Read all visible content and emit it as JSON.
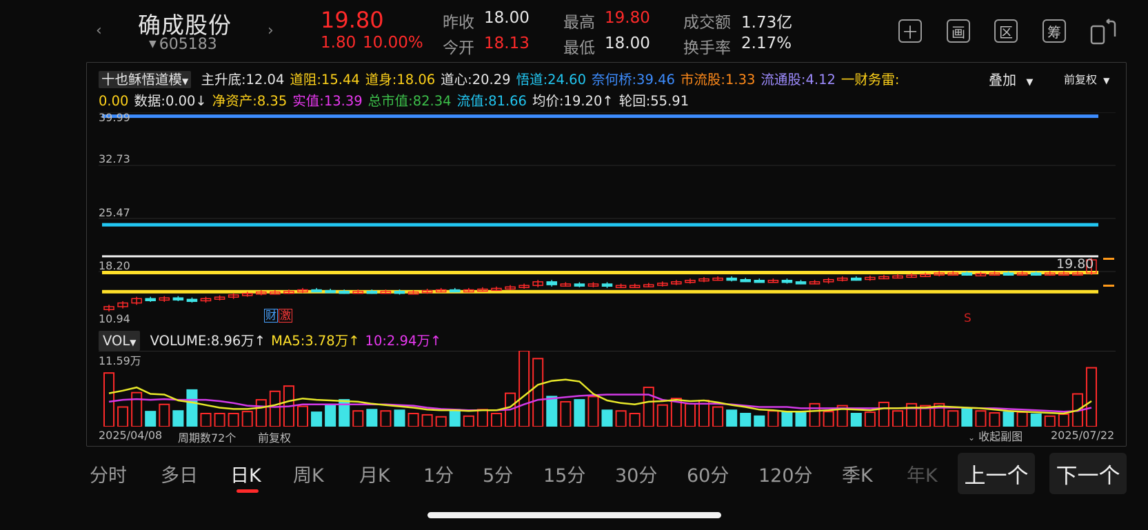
{
  "header": {
    "name": "确成股份",
    "code": "605183",
    "price": "19.80",
    "change": "1.80",
    "change_pct": "10.00%",
    "stats": [
      {
        "label": "昨收",
        "value": "18.00",
        "color": "#e8e8e8"
      },
      {
        "label": "今开",
        "value": "18.13",
        "color": "#ff2a2a"
      },
      {
        "label": "最高",
        "value": "19.80",
        "color": "#ff2a2a"
      },
      {
        "label": "最低",
        "value": "18.00",
        "color": "#e8e8e8"
      },
      {
        "label": "成交额",
        "value": "1.73亿",
        "color": "#e8e8e8"
      },
      {
        "label": "换手率",
        "value": "2.17%",
        "color": "#e8e8e8"
      }
    ],
    "tools": [
      "十",
      "画",
      "区",
      "筹"
    ]
  },
  "indicator": {
    "selector": "十也稣悟道模",
    "line1": [
      {
        "text": "主升底:12.04",
        "color": "#e8e8e8"
      },
      {
        "text": "道阻:15.44",
        "color": "#ffd21a"
      },
      {
        "text": "道身:18.06",
        "color": "#ffd21a"
      },
      {
        "text": "道心:20.29",
        "color": "#e8e8e8"
      },
      {
        "text": "悟道:24.60",
        "color": "#22c7f2"
      },
      {
        "text": "奈何桥:39.46",
        "color": "#3d8dff"
      },
      {
        "text": "市流股:1.33",
        "color": "#ff8a1a"
      },
      {
        "text": "流通股:4.12",
        "color": "#9e8cff"
      },
      {
        "text": "一财务雷:",
        "color": "#ffd21a"
      }
    ],
    "line2": [
      {
        "text": "0.00",
        "color": "#ffd21a"
      },
      {
        "text": "数据:0.00↓",
        "color": "#e8e8e8"
      },
      {
        "text": "净资产:8.35",
        "color": "#ffd21a"
      },
      {
        "text": "实值:13.39",
        "color": "#e838f0"
      },
      {
        "text": "总市值:82.34",
        "color": "#3cc04a"
      },
      {
        "text": "流值:81.66",
        "color": "#22c7f2"
      },
      {
        "text": "均价:19.20↑",
        "color": "#e8e8e8"
      },
      {
        "text": "轮回:55.91",
        "color": "#e8e8e8"
      }
    ],
    "overlay": "叠加",
    "adjust": "前复权"
  },
  "kline": {
    "axis_ticks": [
      "39.99",
      "32.73",
      "25.47",
      "18.20",
      "10.94"
    ],
    "last_price_label": "19.80",
    "marker_cai": "财",
    "marker_ji": "激",
    "marker_s": "S"
  },
  "volume": {
    "selector": "VOL",
    "legend": [
      {
        "text": "VOLUME:8.96万↑",
        "color": "#e8e8e8"
      },
      {
        "text": "MA5:3.78万↑",
        "color": "#ffe02a"
      },
      {
        "text": "10:2.94万↑",
        "color": "#e838f0"
      }
    ],
    "max_label": "11.59万",
    "date_start": "2025/04/08",
    "period_count": "周期数72个",
    "adjust_label": "前复权",
    "collapse": "收起副图",
    "date_end": "2025/07/22"
  },
  "tabs": [
    "分时",
    "多日",
    "日K",
    "周K",
    "月K",
    "1分",
    "5分",
    "15分",
    "30分",
    "60分",
    "120分",
    "季K",
    "年K"
  ],
  "active_tab": "日K",
  "prev_button": "上一个",
  "next_button": "下一个",
  "chart_data": {
    "type": "candlestick",
    "y_range": [
      10.94,
      39.99
    ],
    "reference_lines": [
      {
        "value": 39.46,
        "color": "#3d8dff"
      },
      {
        "value": 24.6,
        "color": "#22c7f2"
      },
      {
        "value": 20.29,
        "color": "#f0f0f0"
      },
      {
        "value": 18.06,
        "color": "#ffe02a"
      },
      {
        "value": 15.44,
        "color": "#ffe02a"
      }
    ],
    "closes": [
      13.4,
      13.9,
      14.5,
      14.3,
      14.6,
      14.4,
      14.2,
      14.5,
      14.7,
      15.0,
      15.2,
      15.4,
      15.4,
      15.5,
      15.7,
      15.6,
      15.5,
      15.4,
      15.5,
      15.4,
      15.5,
      15.3,
      15.4,
      15.6,
      15.7,
      15.6,
      15.7,
      15.8,
      15.9,
      16.1,
      16.3,
      16.8,
      16.4,
      16.5,
      16.3,
      16.5,
      16.2,
      16.3,
      16.3,
      16.4,
      16.6,
      16.8,
      17.0,
      17.2,
      17.3,
      17.1,
      17.0,
      16.9,
      17.0,
      16.8,
      16.7,
      16.8,
      17.1,
      17.3,
      17.2,
      17.4,
      17.5,
      17.6,
      17.7,
      17.8,
      18.0,
      18.0,
      17.9,
      17.9,
      18.0,
      17.9,
      18.0,
      17.9,
      18.0,
      18.0,
      18.0,
      19.8
    ],
    "volumes": [
      8.2,
      3.0,
      5.2,
      2.3,
      3.4,
      2.4,
      5.6,
      2.0,
      2.0,
      2.0,
      2.3,
      4.1,
      5.4,
      6.2,
      3.1,
      2.2,
      3.2,
      4.1,
      2.4,
      2.6,
      2.4,
      2.5,
      2.0,
      1.8,
      1.5,
      2.6,
      1.6,
      2.6,
      2.0,
      5.1,
      11.6,
      10.4,
      4.6,
      3.8,
      4.1,
      4.6,
      2.5,
      2.4,
      2.0,
      6.0,
      3.3,
      4.3,
      3.5,
      4.0,
      3.0,
      2.5,
      2.0,
      1.6,
      2.4,
      2.2,
      2.1,
      3.5,
      2.3,
      3.2,
      2.0,
      2.2,
      3.7,
      2.4,
      3.5,
      3.2,
      3.5,
      2.4,
      2.8,
      2.4,
      2.1,
      2.2,
      2.2,
      1.9,
      1.6,
      1.9,
      5.0,
      9.0
    ],
    "ma5": [
      5.1,
      5.5,
      6.0,
      5.0,
      4.9,
      4.0,
      3.7,
      3.3,
      2.9,
      2.7,
      2.7,
      2.9,
      3.3,
      3.9,
      4.3,
      4.1,
      4.0,
      3.9,
      3.8,
      3.5,
      3.3,
      3.1,
      2.9,
      2.6,
      2.5,
      2.5,
      2.4,
      2.5,
      2.5,
      3.0,
      4.7,
      6.4,
      7.0,
      7.2,
      6.9,
      5.0,
      4.0,
      3.6,
      3.4,
      3.8,
      3.9,
      4.1,
      3.9,
      4.0,
      3.7,
      3.3,
      3.0,
      2.6,
      2.5,
      2.3,
      2.3,
      2.4,
      2.5,
      2.7,
      2.6,
      2.5,
      2.8,
      2.8,
      2.9,
      2.9,
      3.1,
      3.0,
      2.9,
      2.8,
      2.6,
      2.4,
      2.3,
      2.2,
      2.1,
      2.0,
      2.5,
      3.9
    ],
    "ma10": [
      3.8,
      4.1,
      4.2,
      4.1,
      4.2,
      4.1,
      4.1,
      4.1,
      3.9,
      3.6,
      3.2,
      3.1,
      3.0,
      3.1,
      3.4,
      3.4,
      3.4,
      3.4,
      3.4,
      3.4,
      3.4,
      3.3,
      3.2,
      2.9,
      2.7,
      2.6,
      2.5,
      2.5,
      2.5,
      2.6,
      3.4,
      4.1,
      4.3,
      4.5,
      4.7,
      4.8,
      4.9,
      4.9,
      4.9,
      4.9,
      4.1,
      3.8,
      3.5,
      3.5,
      3.5,
      3.4,
      3.2,
      3.0,
      3.0,
      3.0,
      2.8,
      2.8,
      2.8,
      2.8,
      2.8,
      2.8,
      2.8,
      2.8,
      2.8,
      2.8,
      2.9,
      2.9,
      2.9,
      2.8,
      2.8,
      2.7,
      2.6,
      2.5,
      2.4,
      2.3,
      2.4,
      2.9
    ]
  }
}
